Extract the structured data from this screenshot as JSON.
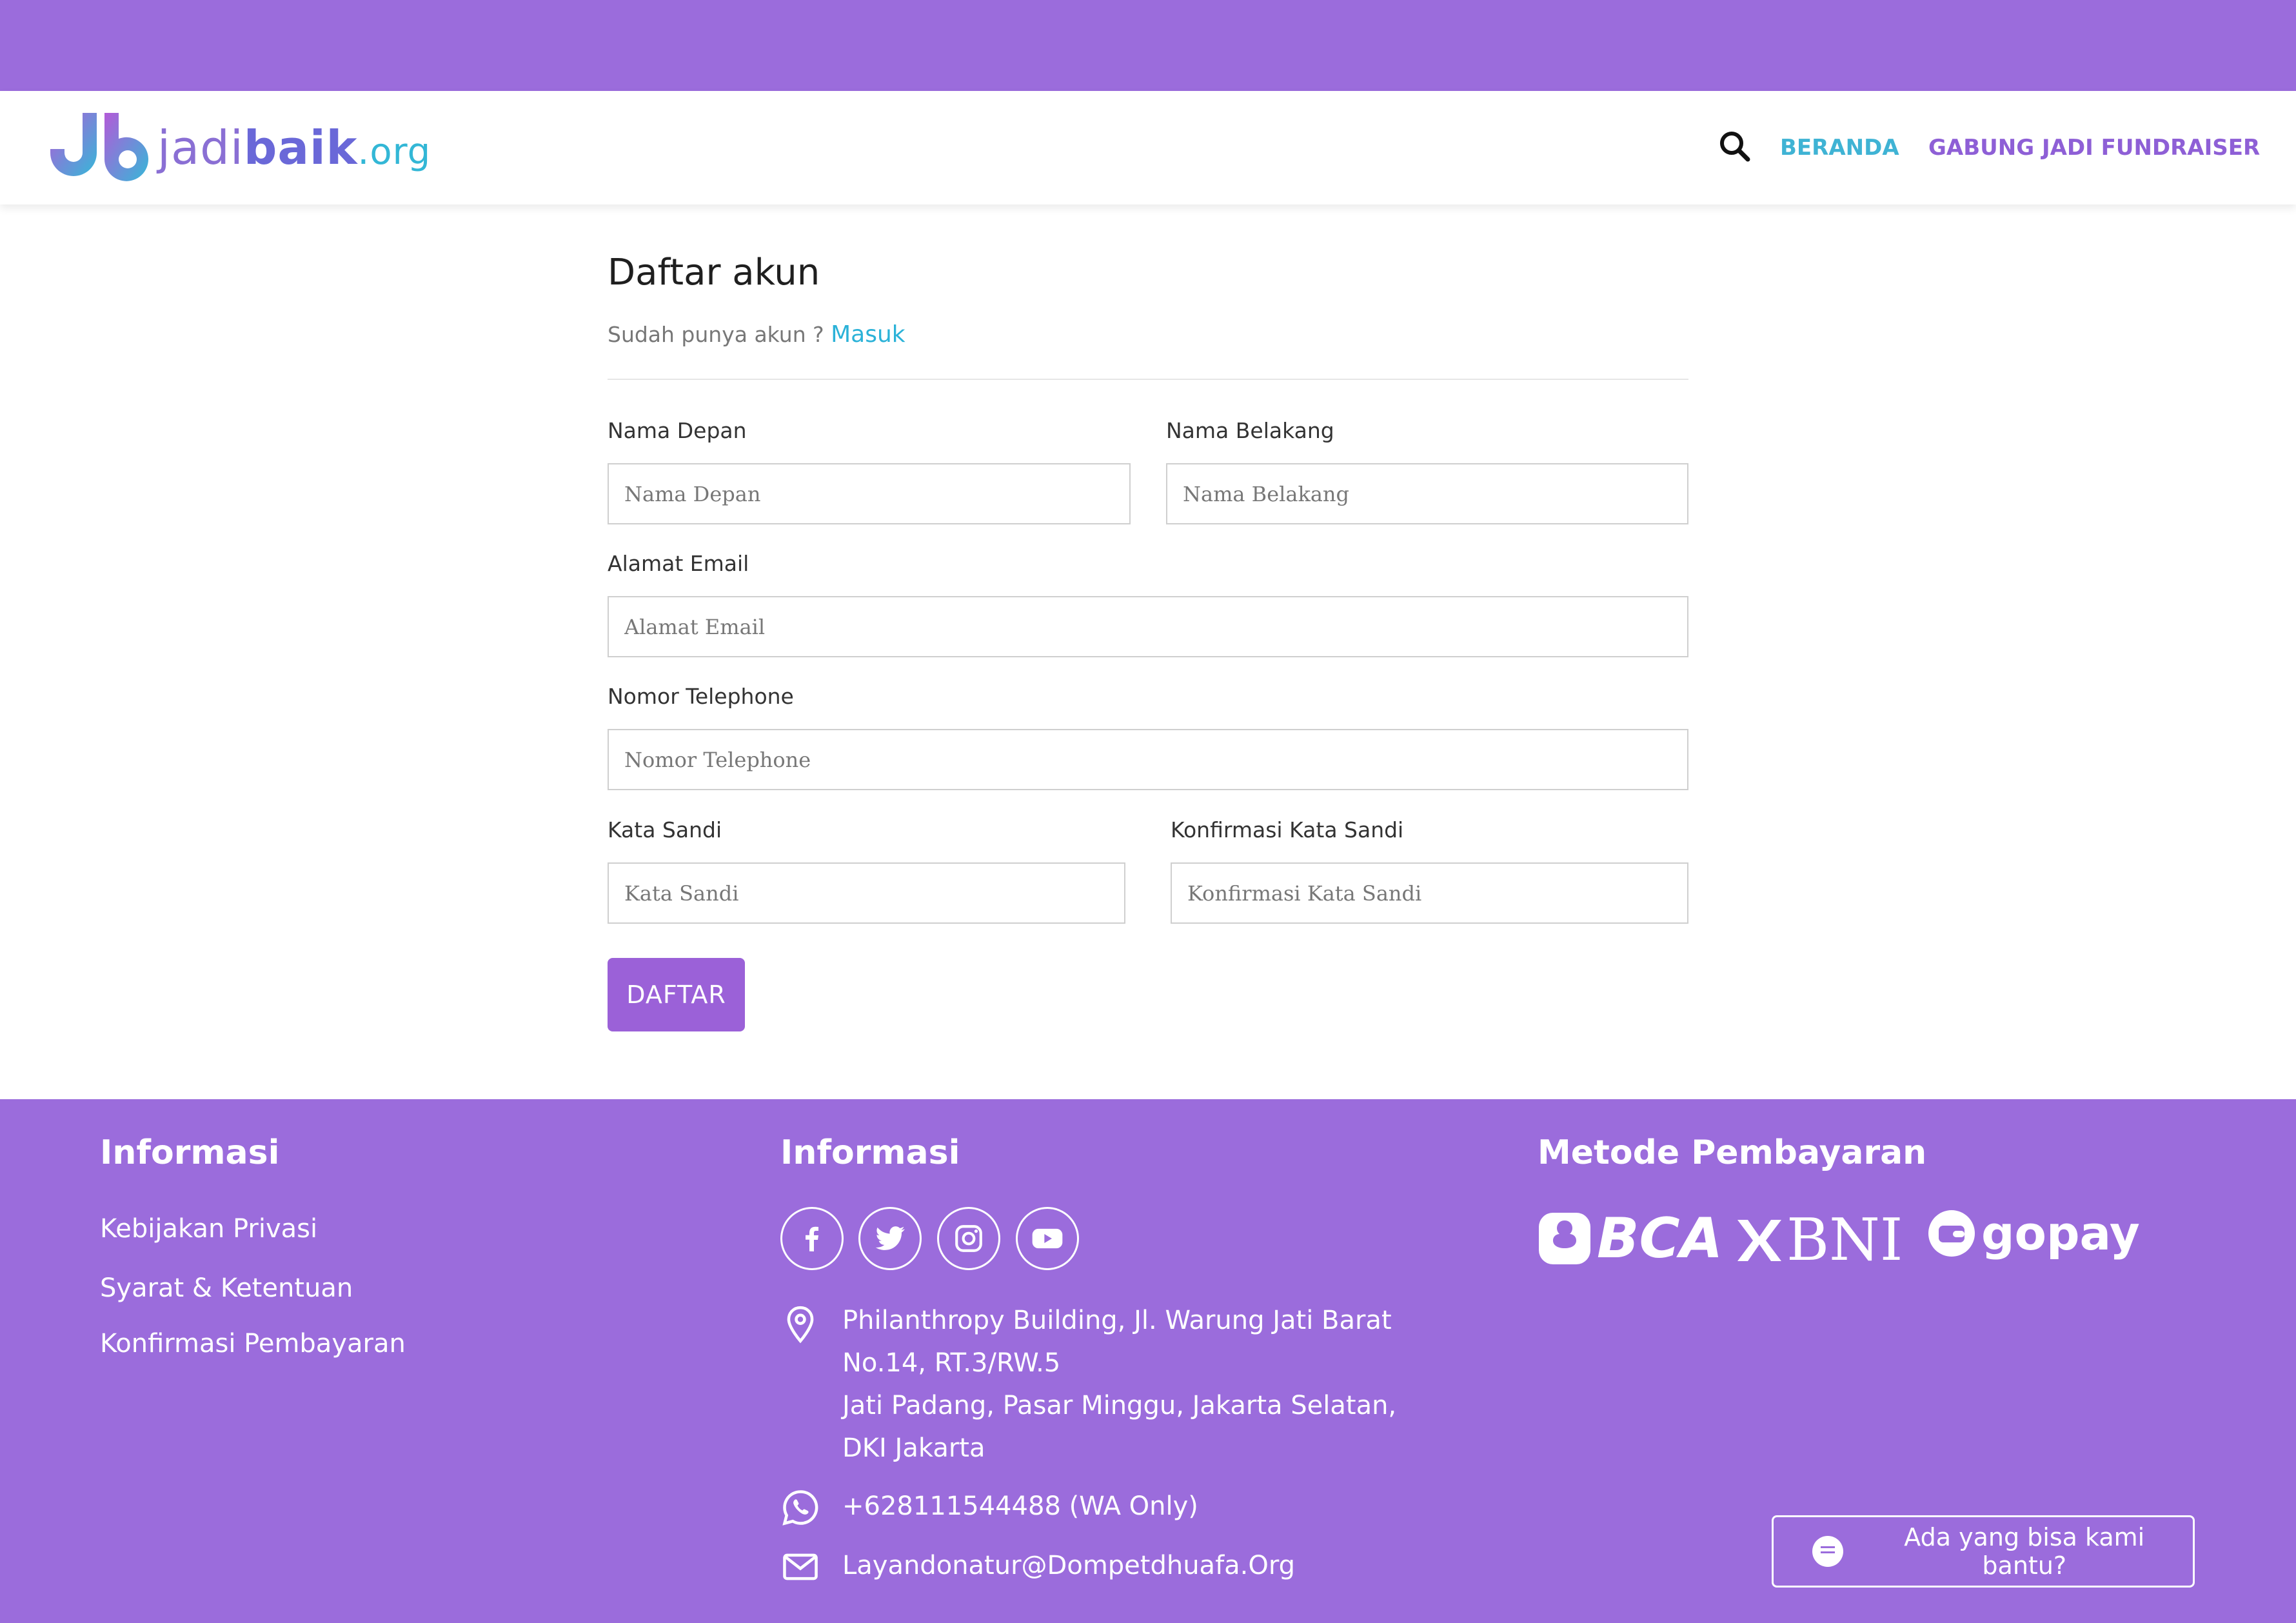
{
  "colors": {
    "brand_purple": "#9b6cdc",
    "accent_blue": "#2bb2d8",
    "button_purple": "#9b61d8"
  },
  "navbar": {
    "logo": {
      "part1": "jadi",
      "part2": "baik",
      "part3": ".org",
      "icon": "jb-logo-icon"
    },
    "search_icon": "search-icon",
    "links": {
      "beranda": "BERANDA",
      "gabung": "GABUNG JADI FUNDRAISER"
    }
  },
  "form": {
    "title": "Daftar akun",
    "subtitle": "Sudah punya akun ?",
    "login_link": "Masuk",
    "fields": {
      "first_name": {
        "label": "Nama Depan",
        "placeholder": "Nama Depan",
        "value": ""
      },
      "last_name": {
        "label": "Nama Belakang",
        "placeholder": "Nama Belakang",
        "value": ""
      },
      "email": {
        "label": "Alamat Email",
        "placeholder": "Alamat Email",
        "value": ""
      },
      "phone": {
        "label": "Nomor Telephone",
        "placeholder": "Nomor Telephone",
        "value": ""
      },
      "password": {
        "label": "Kata Sandi",
        "placeholder": "Kata Sandi",
        "value": ""
      },
      "password_confirm": {
        "label": "Konfirmasi Kata Sandi",
        "placeholder": "Konfirmasi Kata Sandi",
        "value": ""
      }
    },
    "submit_label": "DAFTAR"
  },
  "footer": {
    "col1": {
      "heading": "Informasi",
      "links": [
        "Kebijakan Privasi",
        "Syarat & Ketentuan",
        "Konfirmasi Pembayaran"
      ]
    },
    "col2": {
      "heading": "Informasi",
      "social": [
        "facebook-icon",
        "twitter-icon",
        "instagram-icon",
        "youtube-icon"
      ],
      "address_lines": [
        "Philanthropy Building, Jl. Warung Jati Barat",
        "No.14, RT.3/RW.5",
        "Jati Padang, Pasar Minggu, Jakarta Selatan,",
        "DKI Jakarta"
      ],
      "phone": "+628111544488 (WA Only)",
      "email": "Layandonatur@Dompetdhuafa.Org"
    },
    "col3": {
      "heading": "Metode Pembayaran",
      "methods": [
        "BCA",
        "BNI",
        "gopay"
      ]
    },
    "help_button": "Ada yang bisa kami bantu?"
  }
}
